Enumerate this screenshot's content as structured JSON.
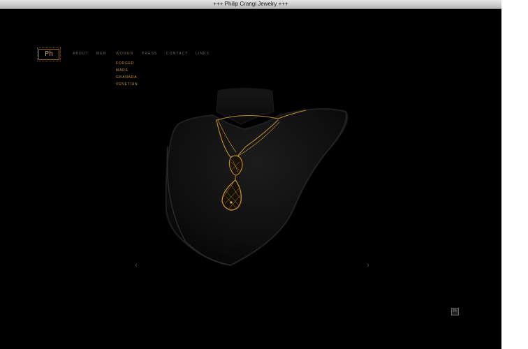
{
  "window": {
    "title": "+++ Philip Crangi Jewelry +++"
  },
  "logo": {
    "text": "Ph"
  },
  "nav": {
    "items": [
      {
        "label": "ABOUT"
      },
      {
        "label": "MEN"
      },
      {
        "label": "WOMEN"
      },
      {
        "label": "PRESS"
      },
      {
        "label": "CONTACT"
      },
      {
        "label": "LINKS"
      }
    ],
    "active": "WOMEN",
    "submenu": [
      {
        "label": "FORGED"
      },
      {
        "label": "MARA"
      },
      {
        "label": "GRANADA"
      },
      {
        "label": "VENETIAN"
      }
    ]
  },
  "gallery": {
    "prev_icon": "‹",
    "next_icon": "›"
  },
  "footer_logo": {
    "text": "Ph"
  },
  "colors": {
    "background": "#000000",
    "gold": "#c79b3a",
    "nav_gray": "#6e6e6e"
  }
}
